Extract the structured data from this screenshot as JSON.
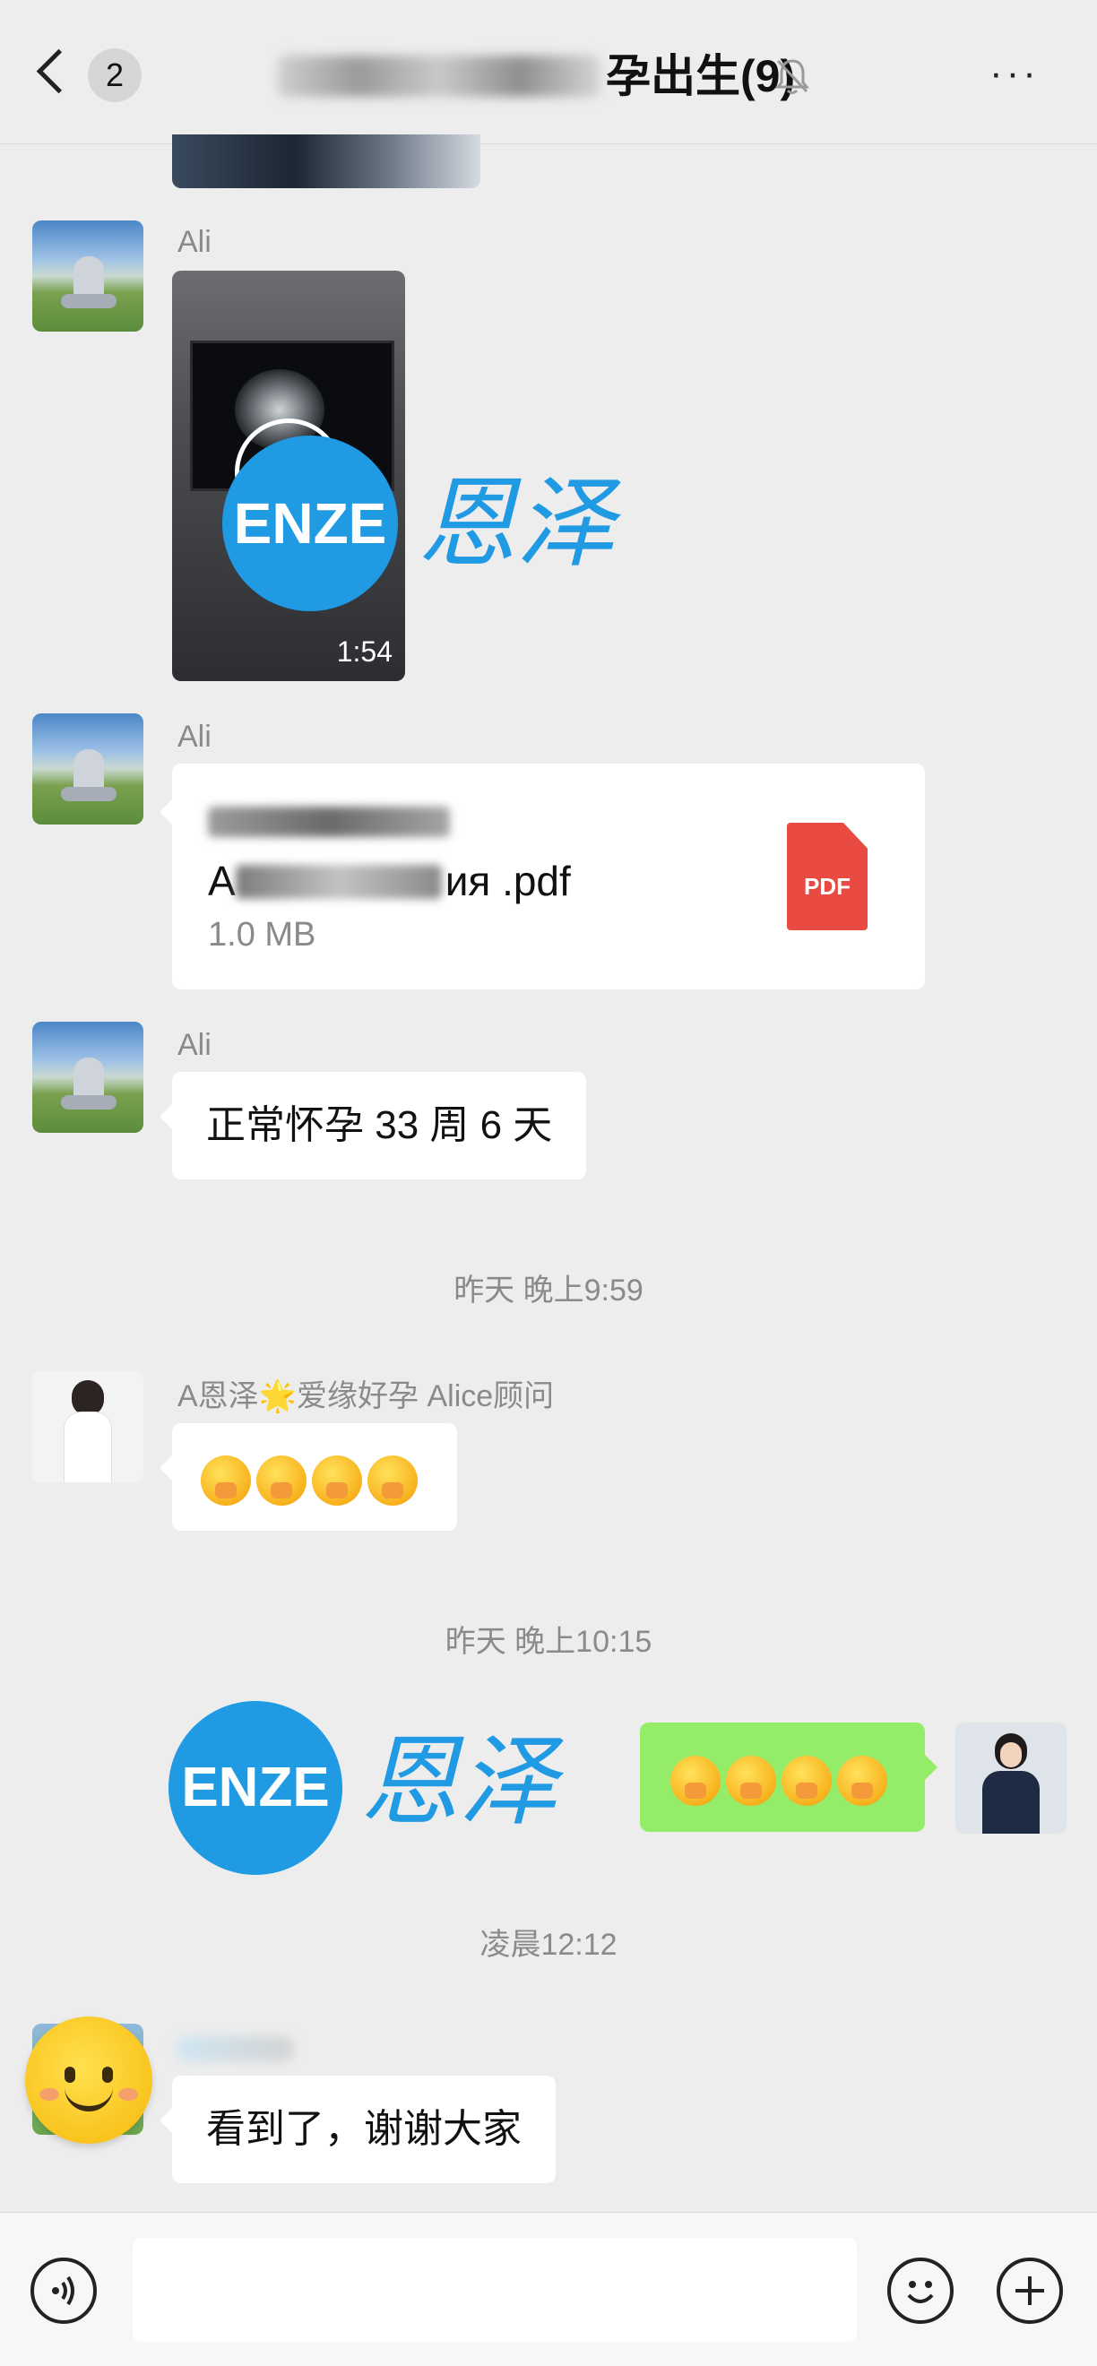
{
  "header": {
    "unread_count": "2",
    "title_visible": "孕出生(9)",
    "muted_icon": "bell-muted-icon",
    "more_label": "···"
  },
  "messages": [
    {
      "sender": "Ali",
      "type": "video",
      "duration": "1:54"
    },
    {
      "sender": "Ali",
      "type": "file",
      "file_name_visible": "ия .pdf",
      "file_name_prefix": "A",
      "file_size": "1.0 MB",
      "file_icon_label": "PDF"
    },
    {
      "sender": "Ali",
      "type": "text",
      "text": "正常怀孕 33 周 6 天"
    }
  ],
  "timestamps": [
    "昨天 晚上9:59",
    "昨天 晚上10:15",
    "凌晨12:12"
  ],
  "alice": {
    "sender": "A恩泽🌟爱缘好孕 Alice顾问",
    "emoji_count": 4
  },
  "my_message": {
    "emoji_count": 4
  },
  "last_message": {
    "text": "看到了，谢谢大家"
  },
  "watermark": {
    "latin": "ENZE",
    "chinese": "恩泽",
    "color": "#1f9ae3"
  },
  "footer": {
    "voice_icon": "voice-icon",
    "emoji_icon": "emoji-icon",
    "plus_icon": "plus-icon"
  },
  "colors": {
    "background": "#ededed",
    "green_bubble": "#95ec69",
    "pdf_red": "#e94b43"
  }
}
